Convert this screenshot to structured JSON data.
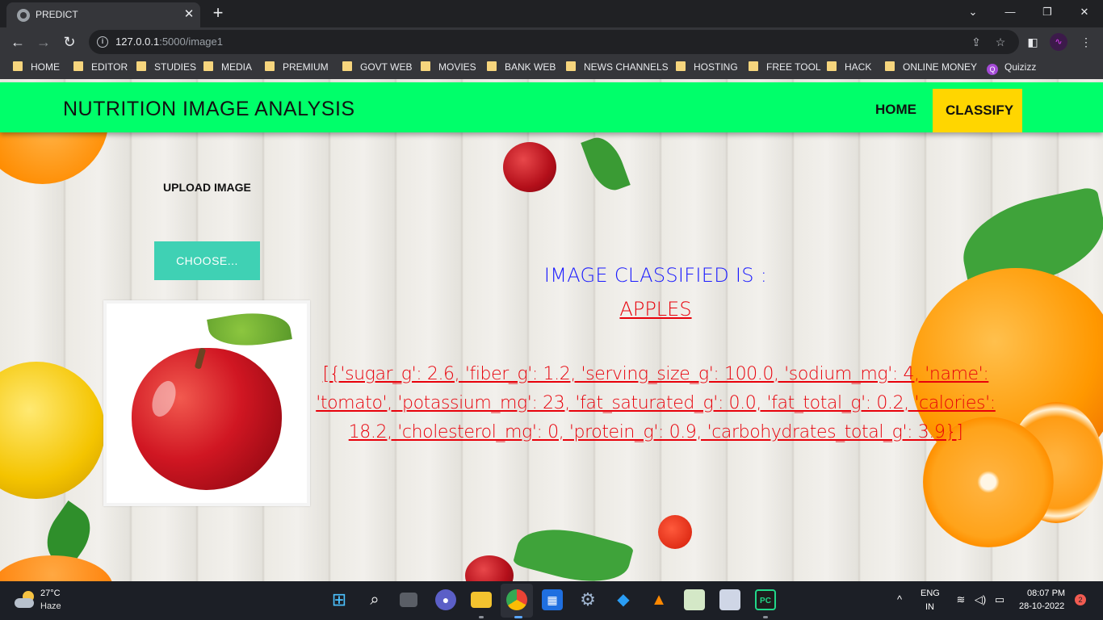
{
  "browser": {
    "tab_title": "PREDICT",
    "url_host": "127.0.0.1",
    "url_rest": ":5000/image1",
    "bookmarks": [
      {
        "label": "HOME",
        "icon": "folder-icon"
      },
      {
        "label": "EDITOR",
        "icon": "folder-icon"
      },
      {
        "label": "STUDIES",
        "icon": "folder-icon"
      },
      {
        "label": "MEDIA",
        "icon": "folder-icon"
      },
      {
        "label": "PREMIUM",
        "icon": "folder-icon"
      },
      {
        "label": "GOVT WEB",
        "icon": "folder-icon"
      },
      {
        "label": "MOVIES",
        "icon": "folder-icon"
      },
      {
        "label": "BANK WEB",
        "icon": "folder-icon"
      },
      {
        "label": "NEWS CHANNELS",
        "icon": "folder-icon"
      },
      {
        "label": "HOSTING",
        "icon": "folder-icon"
      },
      {
        "label": "FREE TOOL",
        "icon": "folder-icon"
      },
      {
        "label": "HACK",
        "icon": "folder-icon"
      },
      {
        "label": "ONLINE MONEY",
        "icon": "folder-icon"
      },
      {
        "label": "Quizizz",
        "icon": "quizizz-icon"
      }
    ]
  },
  "site": {
    "brand": "NUTRITION IMAGE ANALYSIS",
    "nav": {
      "home": "HOME",
      "classify": "CLASSIFY"
    },
    "colors": {
      "navbar": "#00ff6a",
      "active_nav": "#ffd600",
      "choose_button": "#3fd1b4",
      "label_blue": "#1a1aff",
      "result_red": "#e8000a"
    }
  },
  "upload": {
    "label": "UPLOAD IMAGE",
    "button": "CHOOSE..."
  },
  "result": {
    "label": "IMAGE CLASSIFIED IS :",
    "class_name": "APPLES",
    "details": "[{'sugar_g': 2.6, 'fiber_g': 1.2, 'serving_size_g': 100.0, 'sodium_mg': 4, 'name': 'tomato', 'potassium_mg': 23, 'fat_saturated_g': 0.0, 'fat_total_g': 0.2, 'calories': 18.2, 'cholesterol_mg': 0, 'protein_g': 0.9, 'carbohydrates_total_g': 3.9}]"
  },
  "taskbar": {
    "weather_temp": "27°C",
    "weather_desc": "Haze",
    "lang_1": "ENG",
    "lang_2": "IN",
    "time": "08:07 PM",
    "date": "28-10-2022",
    "notifications": "2"
  }
}
